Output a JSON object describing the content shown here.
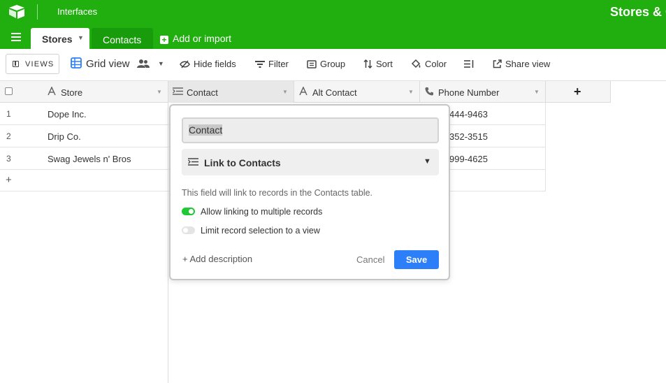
{
  "topbar": {
    "interfaces_label": "Interfaces",
    "base_title": "Stores & C",
    "brand_color": "#20af0f"
  },
  "tabs": {
    "active_label": "Stores",
    "inactive_label": "Contacts",
    "add_import_label": "Add or import"
  },
  "toolbar": {
    "views_label": "VIEWS",
    "grid_view_label": "Grid view",
    "hide_fields_label": "Hide fields",
    "filter_label": "Filter",
    "group_label": "Group",
    "sort_label": "Sort",
    "color_label": "Color",
    "share_view_label": "Share view"
  },
  "grid": {
    "columns": [
      {
        "label": "Store",
        "icon": "text-field-icon"
      },
      {
        "label": "Contact",
        "icon": "link-field-icon"
      },
      {
        "label": "Alt Contact",
        "icon": "text-field-icon"
      },
      {
        "label": "Phone Number",
        "icon": "phone-icon"
      }
    ],
    "rows": [
      {
        "num": "1",
        "store": "Dope Inc.",
        "phone_visible": "444-9463"
      },
      {
        "num": "2",
        "store": "Drip Co.",
        "phone_visible": "352-3515"
      },
      {
        "num": "3",
        "store": "Swag Jewels n' Bros",
        "phone_visible": "999-4625"
      }
    ],
    "add_row_symbol": "+",
    "add_column_symbol": "+"
  },
  "popup": {
    "field_name_value": "Contact",
    "field_type_label": "Link to Contacts",
    "description_text": "This field will link to records in the Contacts table.",
    "option_multiple_label": "Allow linking to multiple records",
    "option_multiple_on": true,
    "option_limit_label": "Limit record selection to a view",
    "option_limit_on": false,
    "add_description_label": "+ Add description",
    "cancel_label": "Cancel",
    "save_label": "Save",
    "save_color": "#2d7ff9"
  }
}
